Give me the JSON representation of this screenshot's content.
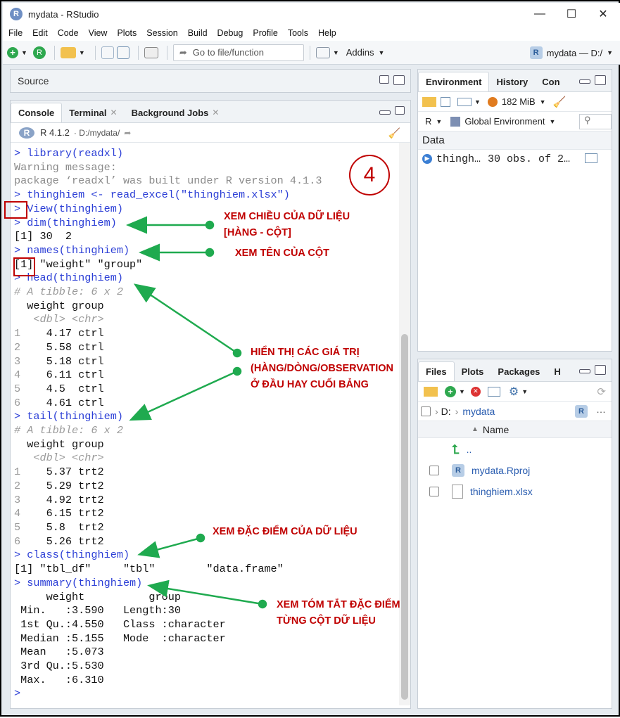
{
  "window": {
    "title": "mydata - RStudio",
    "controls": [
      "minimize",
      "maximize",
      "close"
    ]
  },
  "menu": [
    "File",
    "Edit",
    "Code",
    "View",
    "Plots",
    "Session",
    "Build",
    "Debug",
    "Profile",
    "Tools",
    "Help"
  ],
  "toolbar": {
    "goto_placeholder": "Go to file/function",
    "addins_label": "Addins",
    "project_label": "mydata — D:/"
  },
  "source_pane": {
    "title": "Source"
  },
  "console_pane": {
    "tabs": [
      "Console",
      "Terminal",
      "Background Jobs"
    ],
    "r_version": "R 4.1.2",
    "path": "· D:/mydata/",
    "lines": [
      {
        "t": "cmd",
        "text": "> library(readxl)"
      },
      {
        "t": "warn",
        "text": "Warning message:"
      },
      {
        "t": "warn",
        "text": "package ‘readxl’ was built under R version 4.1.3"
      },
      {
        "t": "cmd",
        "text": "> thinghiem <- read_excel(\"thinghiem.xlsx\")"
      },
      {
        "t": "cmd",
        "text": "> View(thinghiem)"
      },
      {
        "t": "cmd",
        "text": "> dim(thinghiem)"
      },
      {
        "t": "out",
        "text": "[1] 30  2"
      },
      {
        "t": "cmd",
        "text": "> names(thinghiem)"
      },
      {
        "t": "out",
        "text": "[1] \"weight\" \"group\""
      },
      {
        "t": "cmd",
        "text": "> head(thinghiem)"
      },
      {
        "t": "grey",
        "text": "# A tibble: 6 x 2"
      },
      {
        "t": "out",
        "text": "  weight group"
      },
      {
        "t": "grey",
        "text": "   <dbl> <chr>"
      },
      {
        "t": "row",
        "n": "1",
        "text": "    4.17 ctrl"
      },
      {
        "t": "row",
        "n": "2",
        "text": "    5.58 ctrl"
      },
      {
        "t": "row",
        "n": "3",
        "text": "    5.18 ctrl"
      },
      {
        "t": "row",
        "n": "4",
        "text": "    6.11 ctrl"
      },
      {
        "t": "row",
        "n": "5",
        "text": "    4.5  ctrl"
      },
      {
        "t": "row",
        "n": "6",
        "text": "    4.61 ctrl"
      },
      {
        "t": "cmd",
        "text": "> tail(thinghiem)"
      },
      {
        "t": "grey",
        "text": "# A tibble: 6 x 2"
      },
      {
        "t": "out",
        "text": "  weight group"
      },
      {
        "t": "grey",
        "text": "   <dbl> <chr>"
      },
      {
        "t": "row",
        "n": "1",
        "text": "    5.37 trt2"
      },
      {
        "t": "row",
        "n": "2",
        "text": "    5.29 trt2"
      },
      {
        "t": "row",
        "n": "3",
        "text": "    4.92 trt2"
      },
      {
        "t": "row",
        "n": "4",
        "text": "    6.15 trt2"
      },
      {
        "t": "row",
        "n": "5",
        "text": "    5.8  trt2"
      },
      {
        "t": "row",
        "n": "6",
        "text": "    5.26 trt2"
      },
      {
        "t": "cmd",
        "text": "> class(thinghiem)"
      },
      {
        "t": "out",
        "text": "[1] \"tbl_df\"     \"tbl\"        \"data.frame\""
      },
      {
        "t": "cmd",
        "text": "> summary(thinghiem)"
      },
      {
        "t": "out",
        "text": "     weight          group          "
      },
      {
        "t": "out",
        "text": " Min.   :3.590   Length:30         "
      },
      {
        "t": "out",
        "text": " 1st Qu.:4.550   Class :character  "
      },
      {
        "t": "out",
        "text": " Median :5.155   Mode  :character  "
      },
      {
        "t": "out",
        "text": " Mean   :5.073                     "
      },
      {
        "t": "out",
        "text": " 3rd Qu.:5.530                     "
      },
      {
        "t": "out",
        "text": " Max.   :6.310                     "
      },
      {
        "t": "cmd",
        "text": ">"
      }
    ]
  },
  "annotations": {
    "step_number": "4",
    "dim": [
      "XEM CHIỀU CỦA DỮ LIỆU",
      "[HÀNG - CỘT]"
    ],
    "names": "XEM TÊN CỦA CỘT",
    "headtail": [
      "HIỂN THỊ CÁC GIÁ TRỊ",
      "(HÀNG/DÒNG/OBSERVATION",
      "Ở ĐẦU HAY CUỐI BẢNG"
    ],
    "class": "XEM ĐẶC ĐIỂM CỦA DỮ LIỆU",
    "summary": [
      "XEM TÓM TẮT ĐẶC ĐIỂM",
      "TỪNG CỘT DỮ LIỆU"
    ]
  },
  "env_pane": {
    "tabs": [
      "Environment",
      "History",
      "Con"
    ],
    "memory": "182 MiB",
    "r_selector": "R",
    "scope": "Global Environment",
    "section": "Data",
    "object_name": "thingh…",
    "object_desc": "30 obs. of 2…"
  },
  "files_pane": {
    "tabs": [
      "Files",
      "Plots",
      "Packages",
      "H"
    ],
    "breadcrumb_root": "D:",
    "breadcrumb_dir": "mydata",
    "column_name": "Name",
    "files": [
      "..",
      "mydata.Rproj",
      "thinghiem.xlsx"
    ]
  },
  "colors": {
    "annotation_red": "#c00000",
    "arrow_green": "#1faa4f",
    "console_blue": "#2b3ed6"
  }
}
